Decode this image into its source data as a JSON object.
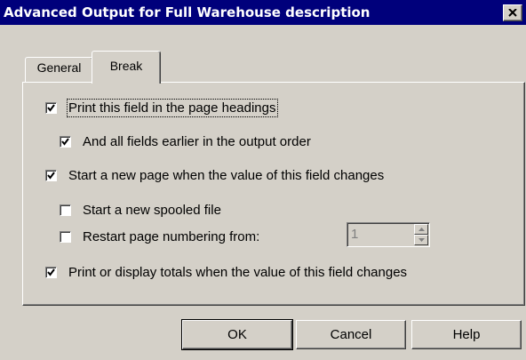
{
  "window": {
    "title": "Advanced Output for Full Warehouse description",
    "close_icon": "close-x-icon"
  },
  "tabs": [
    {
      "label": "General",
      "selected": false
    },
    {
      "label": "Break",
      "selected": true
    }
  ],
  "options": [
    {
      "label": "Print this field in the page headings",
      "checked": true
    },
    {
      "label": "And all fields earlier in the output order",
      "checked": true
    },
    {
      "label": "Start a new page when the value of this field changes",
      "checked": true
    },
    {
      "label": "Start a new spooled file",
      "checked": false
    },
    {
      "label": "Restart page numbering from:",
      "checked": false
    },
    {
      "label": "Print or display totals when the value of this field changes",
      "checked": true
    }
  ],
  "restart_page_number": {
    "value": "1",
    "enabled": false
  },
  "buttons": {
    "ok": "OK",
    "cancel": "Cancel",
    "help": "Help"
  }
}
